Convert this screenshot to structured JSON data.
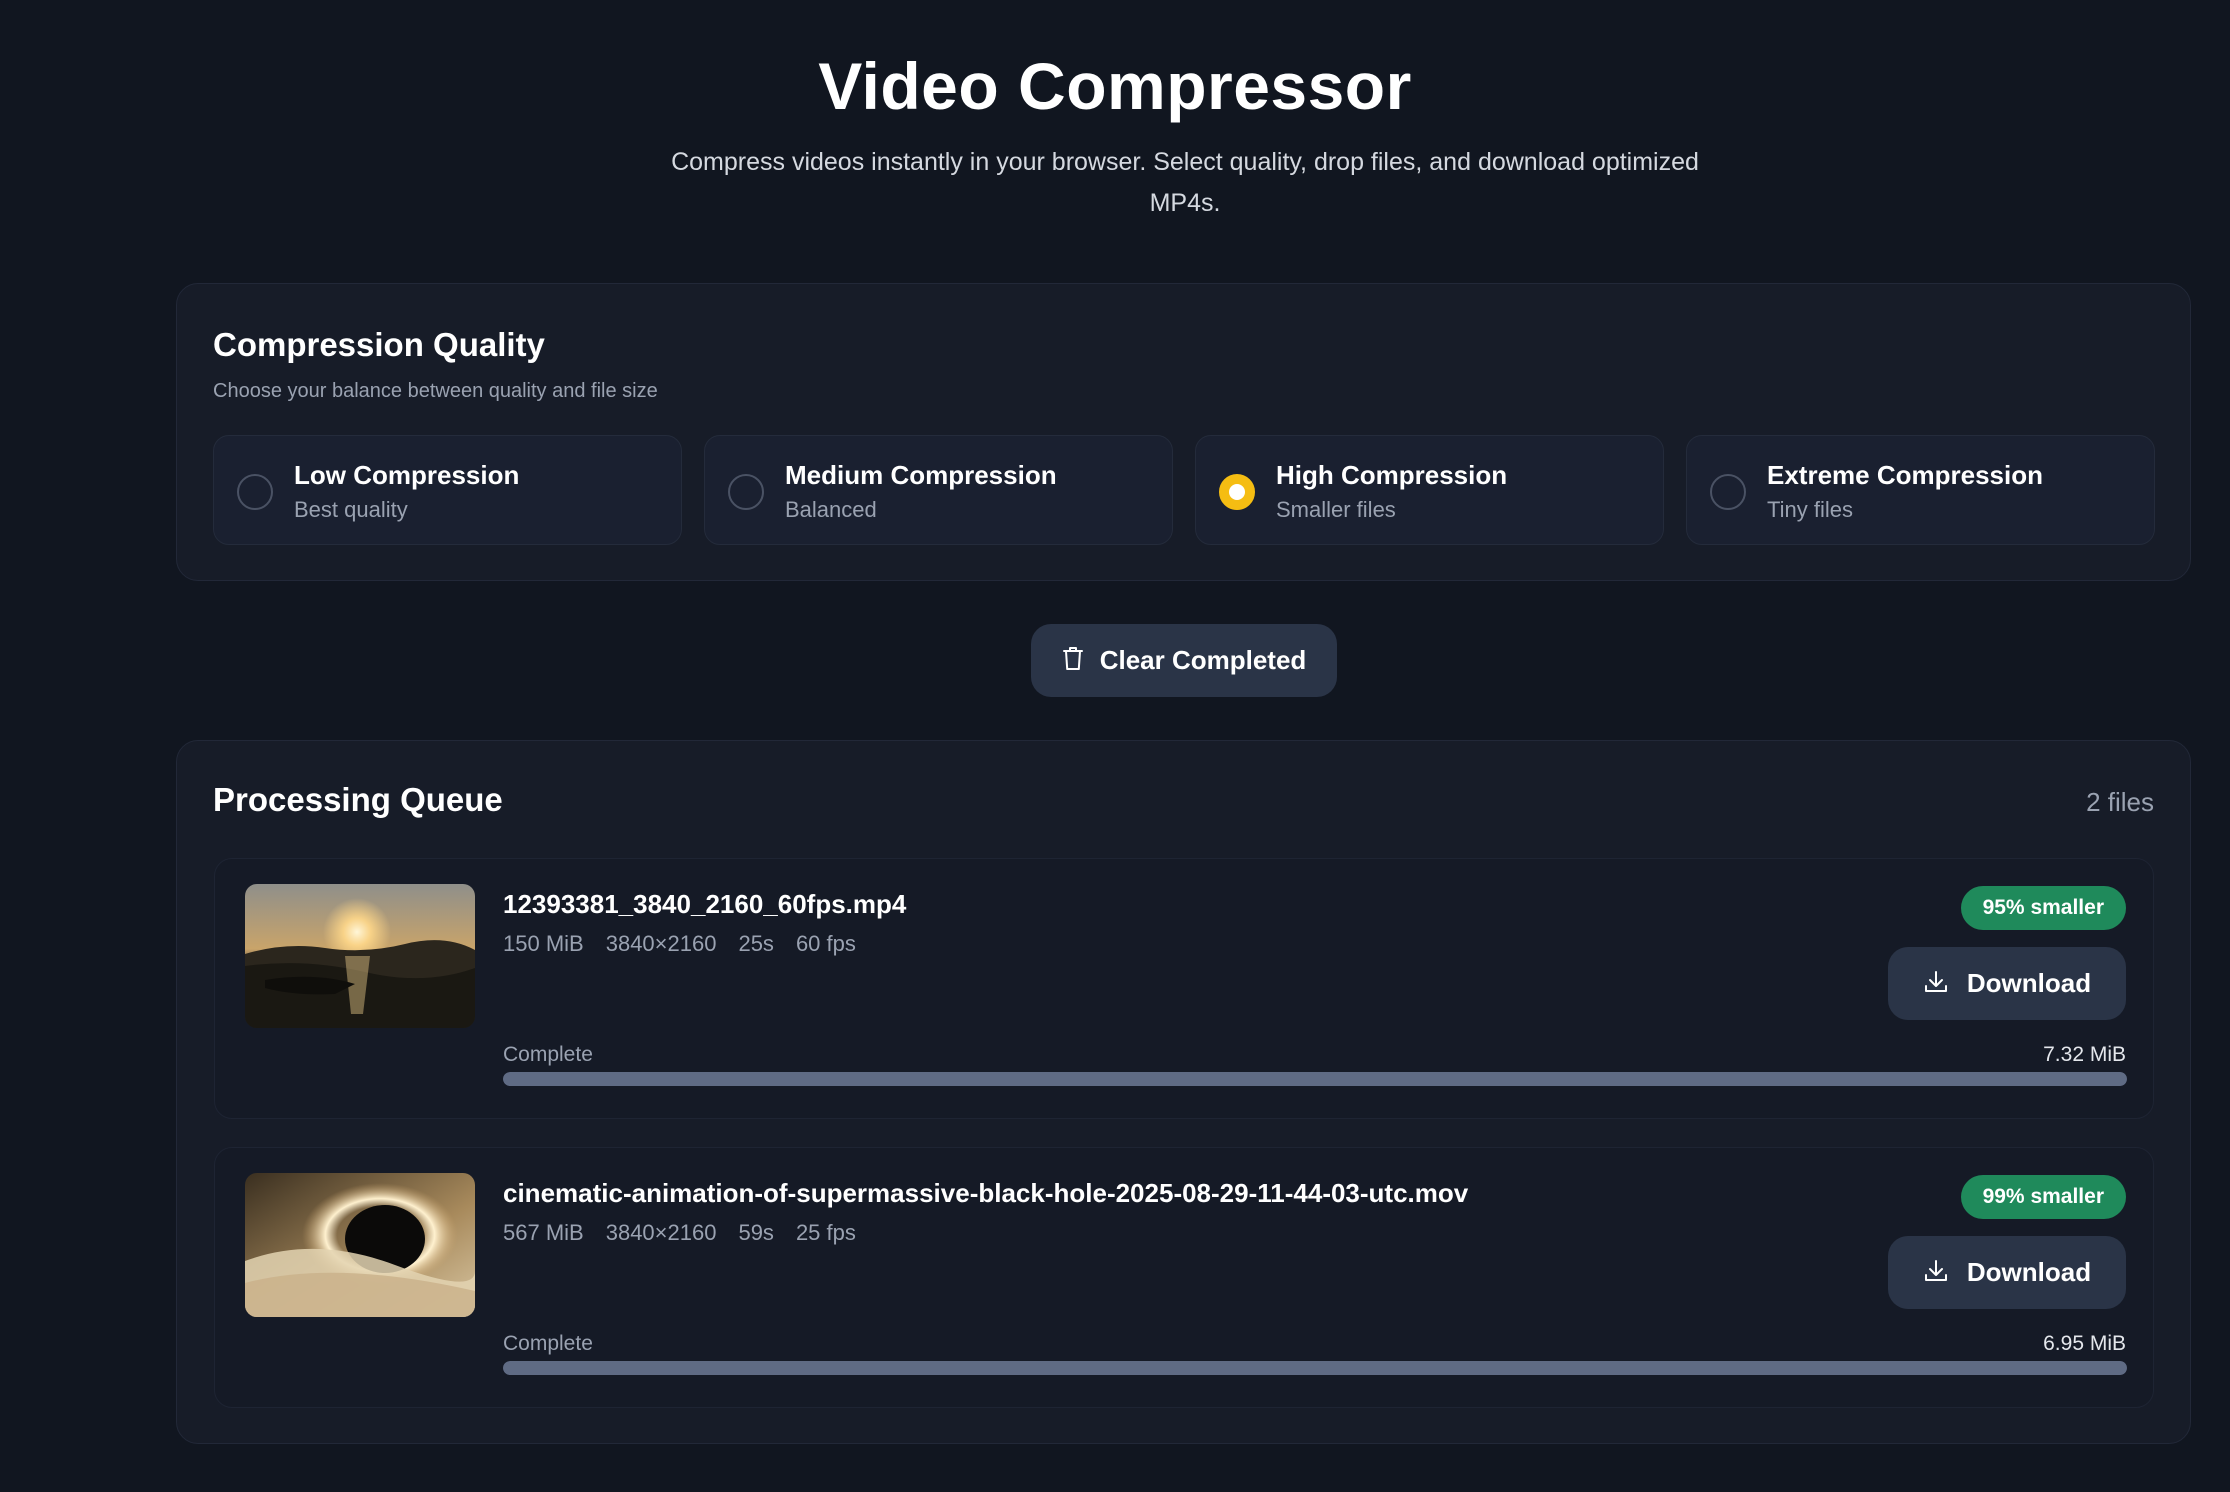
{
  "header": {
    "title": "Video Compressor",
    "subtitle": "Compress videos instantly in your browser. Select quality, drop files, and download optimized MP4s."
  },
  "quality": {
    "title": "Compression Quality",
    "subtitle": "Choose your balance between quality and file size",
    "selected": "high",
    "options": [
      {
        "id": "low",
        "title": "Low Compression",
        "sub": "Best quality"
      },
      {
        "id": "medium",
        "title": "Medium Compression",
        "sub": "Balanced"
      },
      {
        "id": "high",
        "title": "High Compression",
        "sub": "Smaller files"
      },
      {
        "id": "extreme",
        "title": "Extreme Compression",
        "sub": "Tiny files"
      }
    ],
    "accent_color": "#f5bd12"
  },
  "actions": {
    "clear_label": "Clear Completed"
  },
  "queue": {
    "title": "Processing Queue",
    "count": "2 files",
    "items": [
      {
        "name": "12393381_3840_2160_60fps.mp4",
        "size": "150 MiB",
        "resolution": "3840×2160",
        "duration": "25s",
        "fps": "60 fps",
        "badge": "95% smaller",
        "download_label": "Download",
        "status": "Complete",
        "output_size": "7.32 MiB",
        "progress": 100
      },
      {
        "name": "cinematic-animation-of-supermassive-black-hole-2025-08-29-11-44-03-utc.mov",
        "size": "567 MiB",
        "resolution": "3840×2160",
        "duration": "59s",
        "fps": "25 fps",
        "badge": "99% smaller",
        "download_label": "Download",
        "status": "Complete",
        "output_size": "6.95 MiB",
        "progress": 100
      }
    ],
    "badge_color": "#1f8a5b"
  }
}
